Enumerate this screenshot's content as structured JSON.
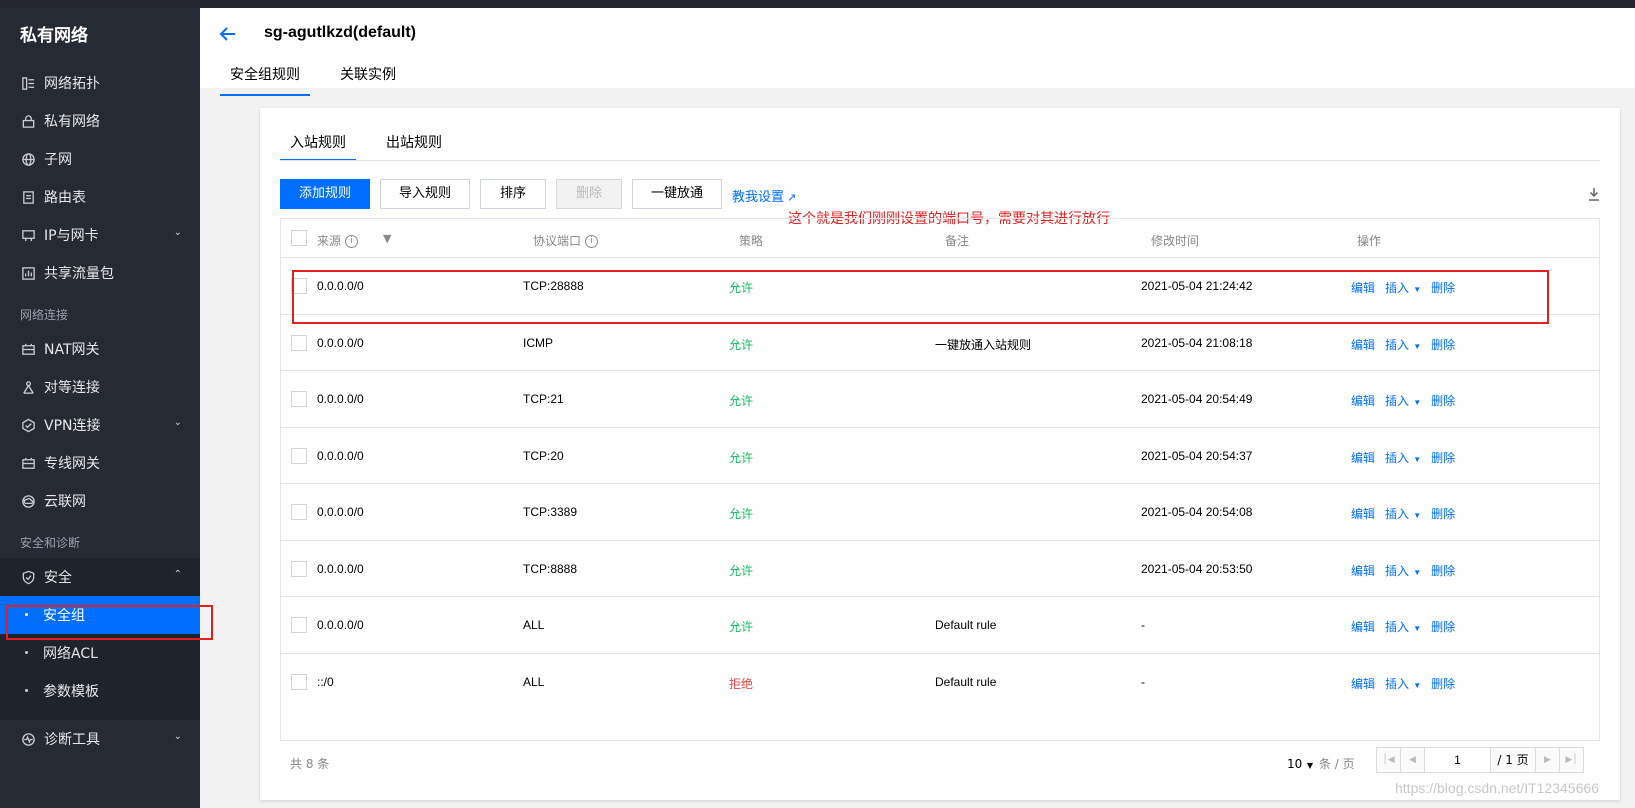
{
  "sidebar": {
    "title": "私有网络",
    "items": [
      {
        "label": "网络拓扑",
        "icon": "topology-icon"
      },
      {
        "label": "私有网络",
        "icon": "lock-icon"
      },
      {
        "label": "子网",
        "icon": "globe-icon"
      },
      {
        "label": "路由表",
        "icon": "document-icon"
      },
      {
        "label": "IP与网卡",
        "icon": "nic-icon"
      },
      {
        "label": "共享流量包",
        "icon": "chart-icon"
      }
    ],
    "group_network": "网络连接",
    "items2": [
      {
        "label": "NAT网关",
        "icon": "gateway-icon"
      },
      {
        "label": "对等连接",
        "icon": "peering-icon"
      },
      {
        "label": "VPN连接",
        "icon": "vpn-icon"
      },
      {
        "label": "专线网关",
        "icon": "gateway-icon"
      },
      {
        "label": "云联网",
        "icon": "cloud-icon"
      }
    ],
    "group_security": "安全和诊断",
    "security": {
      "label": "安全",
      "icon": "shield-icon"
    },
    "security_sub": [
      "安全组",
      "网络ACL",
      "参数模板"
    ],
    "diagnostic": {
      "label": "诊断工具",
      "icon": "diagnostic-icon"
    }
  },
  "header": {
    "title": "sg-agutlkzd(default)",
    "tabs": [
      "安全组规则",
      "关联实例"
    ]
  },
  "card": {
    "tabs": [
      "入站规则",
      "出站规则"
    ],
    "buttons": {
      "add": "添加规则",
      "import": "导入规则",
      "sort": "排序",
      "delete": "删除",
      "open_all": "一键放通"
    },
    "help": "教我设置",
    "annotation": "这个就是我们刚刚设置的端口号，需要对其进行放行"
  },
  "table": {
    "columns": {
      "source": "来源",
      "port": "协议端口",
      "policy": "策略",
      "remark": "备注",
      "modified": "修改时间",
      "ops": "操作"
    },
    "ops": {
      "edit": "编辑",
      "insert": "插入",
      "delete": "删除"
    },
    "rows": [
      {
        "source": "0.0.0.0/0",
        "port": "TCP:28888",
        "policy": "允许",
        "remark": "",
        "time": "2021-05-04 21:24:42"
      },
      {
        "source": "0.0.0.0/0",
        "port": "ICMP",
        "policy": "允许",
        "remark": "一键放通入站规则",
        "time": "2021-05-04 21:08:18"
      },
      {
        "source": "0.0.0.0/0",
        "port": "TCP:21",
        "policy": "允许",
        "remark": "",
        "time": "2021-05-04 20:54:49"
      },
      {
        "source": "0.0.0.0/0",
        "port": "TCP:20",
        "policy": "允许",
        "remark": "",
        "time": "2021-05-04 20:54:37"
      },
      {
        "source": "0.0.0.0/0",
        "port": "TCP:3389",
        "policy": "允许",
        "remark": "",
        "time": "2021-05-04 20:54:08"
      },
      {
        "source": "0.0.0.0/0",
        "port": "TCP:8888",
        "policy": "允许",
        "remark": "",
        "time": "2021-05-04 20:53:50"
      },
      {
        "source": "0.0.0.0/0",
        "port": "ALL",
        "policy": "允许",
        "remark": "Default rule",
        "time": "-"
      },
      {
        "source": "::/0",
        "port": "ALL",
        "policy": "拒绝",
        "remark": "Default rule",
        "time": "-"
      }
    ]
  },
  "pagination": {
    "total": "共 8 条",
    "page_size": "10",
    "page_size_unit": "条 / 页",
    "current_page": "1",
    "of_pages": "/ 1 页"
  },
  "watermark": "https://blog.csdn.net/IT12345666",
  "colors": {
    "accent": "#006eff",
    "allow": "#0abf5b",
    "deny": "#e54545",
    "highlight": "#e32020",
    "sidebar": "#262a33"
  }
}
